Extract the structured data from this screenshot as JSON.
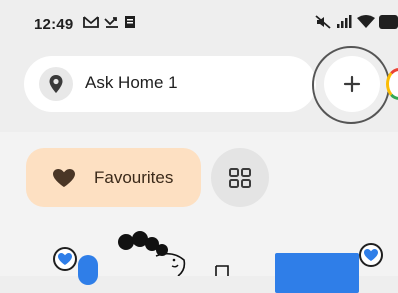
{
  "status_bar": {
    "time": "12:49",
    "left_icons": [
      "gmail-icon",
      "missed-call-icon",
      "message-icon"
    ],
    "right_icons": [
      "mute-icon",
      "signal-icon",
      "wifi-icon",
      "battery-icon"
    ]
  },
  "header": {
    "search_label": "Ask Home 1",
    "add_icon": "plus-icon"
  },
  "chips": {
    "favourites_label": "Favourites",
    "grid_icon": "grid-view-icon"
  },
  "colors": {
    "favourites_bg": "#fde0c2",
    "accent_blue": "#2f7ee8",
    "background": "#eeeeee"
  }
}
